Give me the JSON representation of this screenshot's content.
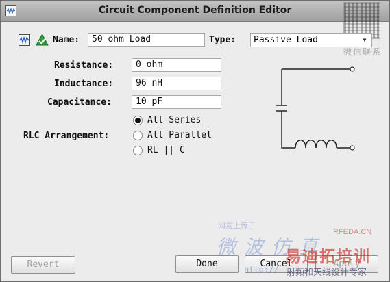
{
  "window": {
    "title": "Circuit Component Definition Editor"
  },
  "header": {
    "name_label": "Name:",
    "name_value": "50 ohm Load",
    "type_label": "Type:",
    "type_value": "Passive Load"
  },
  "params": {
    "resistance_label": "Resistance:",
    "resistance_value": "0 ohm",
    "inductance_label": "Inductance:",
    "inductance_value": "96 nH",
    "capacitance_label": "Capacitance:",
    "capacitance_value": "10 pF",
    "arrangement_label": "RLC Arrangement:"
  },
  "arrangement_options": [
    {
      "label": "All Series",
      "selected": true
    },
    {
      "label": "All Parallel",
      "selected": false
    },
    {
      "label": "RL || C",
      "selected": false
    }
  ],
  "buttons": {
    "revert": "Revert",
    "done": "Done",
    "cancel": "Cancel",
    "apply": "Apply"
  },
  "watermark": {
    "side_text": "微信联系",
    "handwriting": "微波仿真",
    "site": "RFEDA.CN",
    "brand": "易迪拓培训",
    "slogan": "射频和天线设计专家",
    "small": "网友上传于",
    "url": "http://"
  },
  "colors": {
    "accent_green": "#2e9d3a",
    "watermark_red": "#c8281e",
    "watermark_blue": "#7a9cd8"
  }
}
